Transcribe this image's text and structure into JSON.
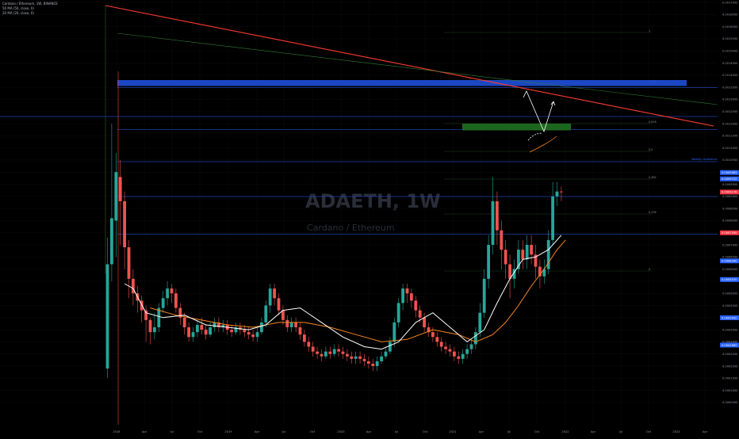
{
  "header": {
    "title": "Cardano / Ethereum, 1W, BINANCE",
    "indicator1": "50 MA (50, close, 0)",
    "indicator2": "20 MA (20, close, 0)"
  },
  "watermark": {
    "symbol": "ADAETH, 1W",
    "name": "Cardano / Ethereum"
  },
  "colors": {
    "up": "#26a69a",
    "down": "#ef5350",
    "trend": "#ff3b30",
    "ma20": "#ffffff",
    "ma50": "#f7861e",
    "zone_blue": "#1e4fd8",
    "zone_green": "#1f6b1f",
    "fib_green": "#3b7a3b"
  },
  "chart_data": {
    "type": "candlestick",
    "price_scale": {
      "ticks": [
        "0.0017000",
        "0.0016500",
        "0.0016000",
        "0.0015500",
        "0.0015000",
        "0.0014500",
        "0.0014000",
        "0.0013500",
        "0.0013000",
        "0.0012500",
        "0.0012000",
        "0.0011500",
        "0.0011000",
        "0.0010500",
        "0.0010000",
        "0.0009500",
        "0.0009000",
        "0.0008500",
        "0.0008000",
        "0.0007500",
        "0.0007000",
        "0.0006500",
        "0.0006000",
        "0.0005500",
        "0.0005000",
        "0.0004500",
        "0.0004000",
        "0.0003500",
        "0.0003000",
        "0.0002500",
        "0.0002000",
        "0.0001500",
        "0.0001000",
        "0.0000500"
      ],
      "levels": [
        {
          "label": "0.0009983",
          "color": "#2962ff"
        },
        {
          "label": "0.0009722",
          "color": "#2962ff"
        },
        {
          "label": "0.0009176",
          "color": "#f23645"
        },
        {
          "label": "0.0007500",
          "color": "#f23645"
        },
        {
          "label": "0.0006340",
          "color": "#2962ff"
        },
        {
          "label": "0.0005570",
          "color": "#2962ff"
        },
        {
          "label": "0.0003992",
          "color": "#2962ff"
        },
        {
          "label": "0.0002865",
          "color": "#2962ff"
        }
      ]
    },
    "time_axis": [
      "2018",
      "Apr",
      "Jul",
      "Oct",
      "2019",
      "Apr",
      "Jul",
      "Oct",
      "2020",
      "Apr",
      "Jul",
      "Oct",
      "2021",
      "Apr",
      "Jul",
      "Oct",
      "2022",
      "Apr",
      "Jul",
      "Oct",
      "2023",
      "Apr"
    ],
    "fib_levels": [
      "1",
      "0.786",
      "0.618",
      "0.5",
      "0.382",
      "0.236",
      "0"
    ],
    "note": "Weekly resistance",
    "candles": [
      [
        0.00019,
        0.00062,
        0.00015,
        0.00073
      ],
      [
        0.00062,
        0.00081,
        0.00055,
        0.0012
      ],
      [
        0.0008,
        0.001,
        0.00065,
        0.00108
      ],
      [
        0.00098,
        0.00088,
        0.0007,
        0.00105
      ],
      [
        0.00088,
        0.00069,
        0.0006,
        0.00092
      ],
      [
        0.00069,
        0.00056,
        0.00048,
        0.00072
      ],
      [
        0.00056,
        0.0005,
        0.00045,
        0.0006
      ],
      [
        0.0005,
        0.00047,
        0.00042,
        0.00053
      ],
      [
        0.00047,
        0.00043,
        0.00038,
        0.00049
      ],
      [
        0.00043,
        0.00039,
        0.0003,
        0.00045
      ],
      [
        0.00039,
        0.00034,
        0.00029,
        0.0004
      ],
      [
        0.00034,
        0.00036,
        0.00031,
        0.00042
      ],
      [
        0.00036,
        0.00044,
        0.00034,
        0.00046
      ],
      [
        0.00044,
        0.00048,
        0.00042,
        0.00051
      ],
      [
        0.00048,
        0.00052,
        0.00045,
        0.00055
      ],
      [
        0.00052,
        0.0005,
        0.00046,
        0.00054
      ],
      [
        0.0005,
        0.00044,
        0.00042,
        0.00052
      ],
      [
        0.00044,
        0.0004,
        0.00037,
        0.00046
      ],
      [
        0.0004,
        0.00036,
        0.00033,
        0.00042
      ],
      [
        0.00036,
        0.00032,
        0.0003,
        0.00038
      ],
      [
        0.00032,
        0.00034,
        0.0003,
        0.00036
      ],
      [
        0.00034,
        0.00037,
        0.00032,
        0.00039
      ],
      [
        0.00037,
        0.00035,
        0.00033,
        0.0004
      ],
      [
        0.00035,
        0.00033,
        0.00031,
        0.00037
      ],
      [
        0.00033,
        0.00036,
        0.00032,
        0.00038
      ],
      [
        0.00036,
        0.00038,
        0.00034,
        0.0004
      ],
      [
        0.00038,
        0.00036,
        0.00034,
        0.0004
      ],
      [
        0.00036,
        0.00037,
        0.00034,
        0.00039
      ],
      [
        0.00037,
        0.00035,
        0.00033,
        0.00039
      ],
      [
        0.00035,
        0.00034,
        0.00032,
        0.00037
      ],
      [
        0.00034,
        0.00036,
        0.00033,
        0.00038
      ],
      [
        0.00036,
        0.00035,
        0.00033,
        0.00038
      ],
      [
        0.00035,
        0.00034,
        0.00032,
        0.00037
      ],
      [
        0.00034,
        0.00033,
        0.00031,
        0.00036
      ],
      [
        0.00033,
        0.00032,
        0.0003,
        0.00035
      ],
      [
        0.00032,
        0.00034,
        0.0003,
        0.00036
      ],
      [
        0.00034,
        0.00038,
        0.00033,
        0.0004
      ],
      [
        0.00038,
        0.00045,
        0.00036,
        0.00047
      ],
      [
        0.00045,
        0.00052,
        0.00042,
        0.00054
      ],
      [
        0.00052,
        0.00048,
        0.00045,
        0.00054
      ],
      [
        0.00048,
        0.00043,
        0.00041,
        0.0005
      ],
      [
        0.00043,
        0.00039,
        0.00037,
        0.00045
      ],
      [
        0.00039,
        0.00036,
        0.00034,
        0.00041
      ],
      [
        0.00036,
        0.00038,
        0.00034,
        0.0004
      ],
      [
        0.00038,
        0.00036,
        0.00034,
        0.0004
      ],
      [
        0.00036,
        0.00033,
        0.00031,
        0.00038
      ],
      [
        0.00033,
        0.0003,
        0.00028,
        0.00035
      ],
      [
        0.0003,
        0.00028,
        0.00026,
        0.00032
      ],
      [
        0.00028,
        0.00026,
        0.00024,
        0.0003
      ],
      [
        0.00026,
        0.00025,
        0.00023,
        0.00028
      ],
      [
        0.00025,
        0.00024,
        0.00022,
        0.00027
      ],
      [
        0.00024,
        0.00026,
        0.00023,
        0.00028
      ],
      [
        0.00026,
        0.00025,
        0.00023,
        0.00028
      ],
      [
        0.00025,
        0.00027,
        0.00024,
        0.00029
      ],
      [
        0.00027,
        0.00026,
        0.00024,
        0.00029
      ],
      [
        0.00026,
        0.00025,
        0.00023,
        0.00028
      ],
      [
        0.00025,
        0.00024,
        0.00022,
        0.00027
      ],
      [
        0.00024,
        0.00023,
        0.00021,
        0.00026
      ],
      [
        0.00023,
        0.00024,
        0.00021,
        0.00026
      ],
      [
        0.00024,
        0.00023,
        0.00021,
        0.00026
      ],
      [
        0.00023,
        0.00022,
        0.0002,
        0.00025
      ],
      [
        0.00022,
        0.00021,
        0.00019,
        0.00024
      ],
      [
        0.00021,
        0.0002,
        0.00018,
        0.00023
      ],
      [
        0.0002,
        0.00022,
        0.00018,
        0.00024
      ],
      [
        0.00022,
        0.00024,
        0.00021,
        0.00026
      ],
      [
        0.00024,
        0.00026,
        0.00023,
        0.00028
      ],
      [
        0.00026,
        0.0003,
        0.00025,
        0.00032
      ],
      [
        0.0003,
        0.00038,
        0.00028,
        0.0004
      ],
      [
        0.00038,
        0.00046,
        0.00036,
        0.00048
      ],
      [
        0.00046,
        0.00052,
        0.00043,
        0.00054
      ],
      [
        0.00052,
        0.0005,
        0.00046,
        0.00054
      ],
      [
        0.0005,
        0.00047,
        0.00044,
        0.00052
      ],
      [
        0.00047,
        0.00043,
        0.0004,
        0.00049
      ],
      [
        0.00043,
        0.0004,
        0.00038,
        0.00045
      ],
      [
        0.0004,
        0.00036,
        0.00034,
        0.00042
      ],
      [
        0.00036,
        0.00034,
        0.00032,
        0.00038
      ],
      [
        0.00034,
        0.00032,
        0.0003,
        0.00036
      ],
      [
        0.00032,
        0.0003,
        0.00028,
        0.00034
      ],
      [
        0.0003,
        0.00028,
        0.00026,
        0.00032
      ],
      [
        0.00028,
        0.00027,
        0.00025,
        0.0003
      ],
      [
        0.00027,
        0.00026,
        0.00024,
        0.00029
      ],
      [
        0.00026,
        0.00024,
        0.00022,
        0.00028
      ],
      [
        0.00024,
        0.00023,
        0.00021,
        0.00026
      ],
      [
        0.00023,
        0.00025,
        0.00021,
        0.00027
      ],
      [
        0.00025,
        0.00027,
        0.00023,
        0.00029
      ],
      [
        0.00027,
        0.00029,
        0.00025,
        0.00031
      ],
      [
        0.00029,
        0.00034,
        0.00027,
        0.00036
      ],
      [
        0.00034,
        0.00042,
        0.00032,
        0.00046
      ],
      [
        0.00042,
        0.00056,
        0.0004,
        0.0006
      ],
      [
        0.00056,
        0.0007,
        0.00052,
        0.00074
      ],
      [
        0.0007,
        0.00088,
        0.00066,
        0.00098
      ],
      [
        0.00088,
        0.00076,
        0.0007,
        0.00092
      ],
      [
        0.00076,
        0.00068,
        0.0006,
        0.0008
      ],
      [
        0.00068,
        0.00062,
        0.00056,
        0.00072
      ],
      [
        0.00062,
        0.00056,
        0.00048,
        0.00066
      ],
      [
        0.00056,
        0.0006,
        0.00052,
        0.00064
      ],
      [
        0.0006,
        0.00068,
        0.00058,
        0.00072
      ],
      [
        0.00068,
        0.00064,
        0.0006,
        0.00072
      ],
      [
        0.00064,
        0.0007,
        0.0006,
        0.00074
      ],
      [
        0.0007,
        0.00066,
        0.00062,
        0.00074
      ],
      [
        0.00066,
        0.00061,
        0.00056,
        0.0007
      ],
      [
        0.00061,
        0.00057,
        0.00052,
        0.00064
      ],
      [
        0.00057,
        0.0006,
        0.00054,
        0.00064
      ],
      [
        0.0006,
        0.00072,
        0.00058,
        0.00076
      ],
      [
        0.00072,
        0.0009,
        0.0007,
        0.00096
      ],
      [
        0.0009,
        0.00092,
        0.00086,
        0.00096
      ],
      [
        0.00092,
        0.000917,
        0.00088,
        0.00094
      ]
    ],
    "ma20": [
      [
        4,
        0.00054
      ],
      [
        6,
        0.00052
      ],
      [
        9,
        0.00042
      ],
      [
        13,
        0.0004
      ],
      [
        18,
        0.00041
      ],
      [
        23,
        0.00037
      ],
      [
        28,
        0.00036
      ],
      [
        33,
        0.00035
      ],
      [
        37,
        0.00037
      ],
      [
        41,
        0.00043
      ],
      [
        45,
        0.00044
      ],
      [
        50,
        0.00038
      ],
      [
        55,
        0.00032
      ],
      [
        60,
        0.00028
      ],
      [
        64,
        0.00027
      ],
      [
        68,
        0.0003
      ],
      [
        72,
        0.00038
      ],
      [
        76,
        0.00042
      ],
      [
        80,
        0.00036
      ],
      [
        84,
        0.0003
      ],
      [
        88,
        0.00035
      ],
      [
        91,
        0.00046
      ],
      [
        94,
        0.00056
      ],
      [
        97,
        0.00064
      ],
      [
        100,
        0.00065
      ],
      [
        103,
        0.00068
      ],
      [
        106,
        0.00074
      ]
    ],
    "ma50": [
      [
        10,
        0.00044
      ],
      [
        16,
        0.00041
      ],
      [
        22,
        0.00039
      ],
      [
        28,
        0.00037
      ],
      [
        34,
        0.00036
      ],
      [
        40,
        0.00038
      ],
      [
        46,
        0.00038
      ],
      [
        52,
        0.00036
      ],
      [
        58,
        0.00033
      ],
      [
        64,
        0.0003
      ],
      [
        70,
        0.00031
      ],
      [
        76,
        0.00035
      ],
      [
        82,
        0.00033
      ],
      [
        86,
        0.0003
      ],
      [
        90,
        0.00033
      ],
      [
        93,
        0.00038
      ],
      [
        96,
        0.00045
      ],
      [
        99,
        0.00053
      ],
      [
        102,
        0.0006
      ],
      [
        105,
        0.00068
      ],
      [
        107,
        0.00072
      ]
    ]
  }
}
